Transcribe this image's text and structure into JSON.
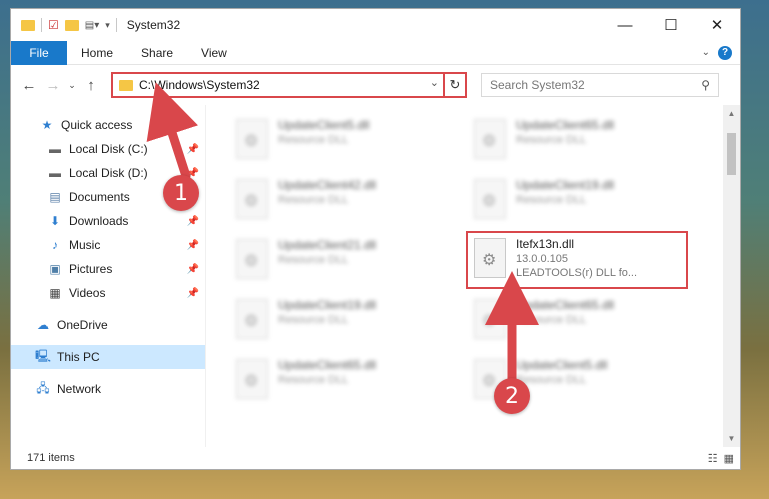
{
  "window": {
    "title": "System32"
  },
  "controls": {
    "minimize": "—",
    "maximize": "☐",
    "close": "✕"
  },
  "ribbon": {
    "tabs": [
      "File",
      "Home",
      "Share",
      "View"
    ]
  },
  "address": {
    "path": "C:\\Windows\\System32"
  },
  "search": {
    "placeholder": "Search System32"
  },
  "sidebar": {
    "items": [
      {
        "label": "Quick access",
        "icon": "star-icon",
        "pinned": false
      },
      {
        "label": "Local Disk (C:)",
        "icon": "drive-icon",
        "pinned": true
      },
      {
        "label": "Local Disk (D:)",
        "icon": "drive-icon",
        "pinned": true
      },
      {
        "label": "Documents",
        "icon": "documents-icon",
        "pinned": true
      },
      {
        "label": "Downloads",
        "icon": "downloads-icon",
        "pinned": true
      },
      {
        "label": "Music",
        "icon": "music-icon",
        "pinned": true
      },
      {
        "label": "Pictures",
        "icon": "pictures-icon",
        "pinned": true
      },
      {
        "label": "Videos",
        "icon": "videos-icon",
        "pinned": true
      },
      {
        "label": "OneDrive",
        "icon": "cloud-icon",
        "pinned": false
      },
      {
        "label": "This PC",
        "icon": "computer-icon",
        "pinned": false,
        "selected": true
      },
      {
        "label": "Network",
        "icon": "network-icon",
        "pinned": false
      }
    ]
  },
  "files": [
    {
      "name": "UpdateClient5.dll",
      "desc": "Resource DLL"
    },
    {
      "name": "UpdateClient65.dll",
      "desc": "Resource DLL"
    },
    {
      "name": "UpdateClient42.dll",
      "desc": "Resource DLL"
    },
    {
      "name": "UpdateClient19.dll",
      "desc": "Resource DLL"
    },
    {
      "name": "UpdateClient21.dll",
      "desc": "Resource DLL"
    },
    {
      "name": "Itefx13n.dll",
      "version": "13.0.0.105",
      "desc": "LEADTOOLS(r) DLL fo..."
    },
    {
      "name": "UpdateClient19.dll",
      "desc": "Resource DLL"
    },
    {
      "name": "UpdateClient65.dll",
      "desc": "Resource DLL"
    },
    {
      "name": "UpdateClient65.dll",
      "desc": "Resource DLL"
    },
    {
      "name": "UpdateClient5.dll",
      "desc": "Resource DLL"
    }
  ],
  "status": {
    "count": "171 items"
  },
  "callouts": [
    "1",
    "2"
  ],
  "colors": {
    "accent": "#1979ca",
    "highlight": "#d9474b",
    "selected": "#cce8ff"
  }
}
